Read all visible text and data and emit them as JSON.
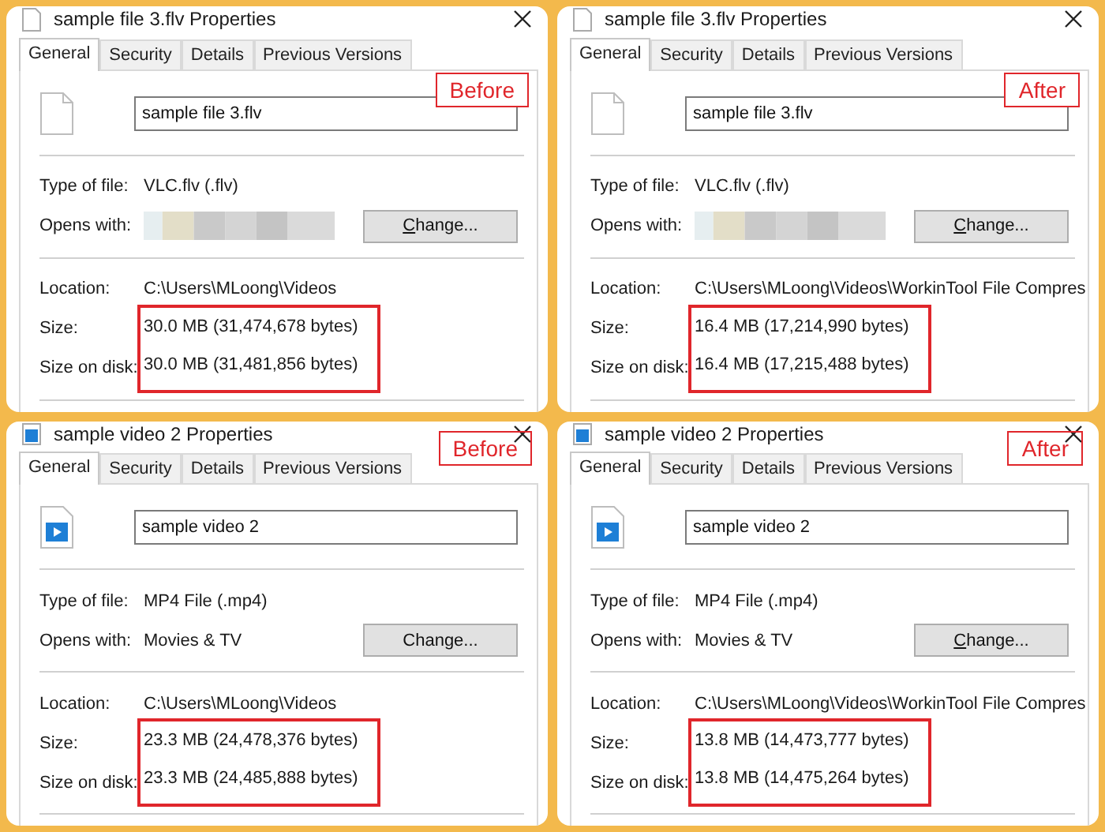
{
  "panels": [
    {
      "title": "sample file 3.flv Properties",
      "file_icon": {
        "kind": "document"
      },
      "badge": {
        "text": "Before",
        "over_title_bar": false
      },
      "tabs": [
        {
          "label": "General",
          "selected": true
        },
        {
          "label": "Security",
          "selected": false
        },
        {
          "label": "Details",
          "selected": false
        },
        {
          "label": "Previous Versions",
          "selected": false
        }
      ],
      "file_name": "sample file 3.flv",
      "type_label": "Type of file:",
      "type_value": "VLC.flv (.flv)",
      "opens_label": "Opens with:",
      "opens_with": {
        "kind": "blurred"
      },
      "change_button": {
        "label": "Change...",
        "mnemonic_shown": true
      },
      "location_label": "Location:",
      "location_value": "C:\\Users\\MLoong\\Videos",
      "size_label": "Size:",
      "size_value": "30.0 MB (31,474,678 bytes)",
      "disk_label": "Size on disk:",
      "disk_value": "30.0 MB (31,481,856 bytes)"
    },
    {
      "title": "sample file 3.flv Properties",
      "file_icon": {
        "kind": "document"
      },
      "badge": {
        "text": "After",
        "over_title_bar": false
      },
      "tabs": [
        {
          "label": "General",
          "selected": true
        },
        {
          "label": "Security",
          "selected": false
        },
        {
          "label": "Details",
          "selected": false
        },
        {
          "label": "Previous Versions",
          "selected": false
        }
      ],
      "file_name": "sample file 3.flv",
      "type_label": "Type of file:",
      "type_value": "VLC.flv (.flv)",
      "opens_label": "Opens with:",
      "opens_with": {
        "kind": "blurred"
      },
      "change_button": {
        "label": "Change...",
        "mnemonic_shown": true
      },
      "location_label": "Location:",
      "location_value": "C:\\Users\\MLoong\\Videos\\WorkinTool File Compres",
      "size_label": "Size:",
      "size_value": "16.4 MB (17,214,990 bytes)",
      "disk_label": "Size on disk:",
      "disk_value": "16.4 MB (17,215,488 bytes)"
    },
    {
      "title": "sample video 2 Properties",
      "file_icon": {
        "kind": "video"
      },
      "badge": {
        "text": "Before",
        "over_title_bar": true
      },
      "tabs": [
        {
          "label": "General",
          "selected": true
        },
        {
          "label": "Security",
          "selected": false
        },
        {
          "label": "Details",
          "selected": false
        },
        {
          "label": "Previous Versions",
          "selected": false
        }
      ],
      "file_name": "sample video 2",
      "type_label": "Type of file:",
      "type_value": "MP4 File (.mp4)",
      "opens_label": "Opens with:",
      "opens_with": {
        "kind": "text",
        "text": "Movies & TV"
      },
      "change_button": {
        "label": "Change...",
        "mnemonic_shown": false
      },
      "location_label": "Location:",
      "location_value": "C:\\Users\\MLoong\\Videos",
      "size_label": "Size:",
      "size_value": "23.3 MB (24,478,376 bytes)",
      "disk_label": "Size on disk:",
      "disk_value": "23.3 MB (24,485,888 bytes)"
    },
    {
      "title": "sample video 2 Properties",
      "file_icon": {
        "kind": "video"
      },
      "badge": {
        "text": "After",
        "over_title_bar": true
      },
      "tabs": [
        {
          "label": "General",
          "selected": true
        },
        {
          "label": "Security",
          "selected": false
        },
        {
          "label": "Details",
          "selected": false
        },
        {
          "label": "Previous Versions",
          "selected": false
        }
      ],
      "file_name": "sample video 2",
      "type_label": "Type of file:",
      "type_value": "MP4 File (.mp4)",
      "opens_label": "Opens with:",
      "opens_with": {
        "kind": "text",
        "text": "Movies & TV"
      },
      "change_button": {
        "label": "Change...",
        "mnemonic_shown": true
      },
      "location_label": "Location:",
      "location_value": "C:\\Users\\MLoong\\Videos\\WorkinTool File Compres",
      "size_label": "Size:",
      "size_value": "13.8 MB (14,473,777 bytes)",
      "disk_label": "Size on disk:",
      "disk_value": "13.8 MB (14,475,264 bytes)"
    }
  ]
}
